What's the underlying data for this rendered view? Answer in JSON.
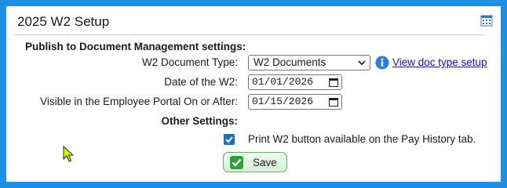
{
  "header": {
    "title": "2025 W2 Setup",
    "calendar_icon": "calendar-icon"
  },
  "publish_section": {
    "heading": "Publish to Document Management settings:",
    "doc_type_label": "W2 Document Type:",
    "doc_type_value": "W2 Documents",
    "info_icon": "info-icon",
    "doc_type_link": "View doc type setup",
    "date_label": "Date of the W2:",
    "date_value": "01/01/2026",
    "visible_label": "Visible in the Employee Portal On or After:",
    "visible_value": "01/15/2026"
  },
  "other_section": {
    "heading": "Other Settings:",
    "print_checkbox_checked": true,
    "print_checkbox_label": "Print W2 button available on the Pay History tab."
  },
  "actions": {
    "save_label": "Save"
  },
  "colors": {
    "frame": "#1e8fe3",
    "checkbox": "#1f6fb2",
    "save_check": "#2e9e3e",
    "cursor": "#d4ff00"
  }
}
